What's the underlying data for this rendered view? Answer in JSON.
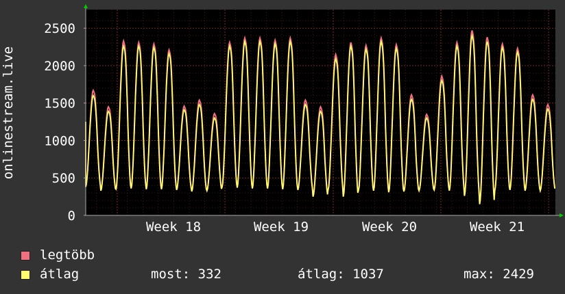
{
  "chart_data": {
    "type": "line",
    "ylabel": "onlinestream.live",
    "yticks": [
      0,
      500,
      1000,
      1500,
      2000,
      2500
    ],
    "ylim": [
      0,
      2700
    ],
    "xticks": [
      "Week 18",
      "Week 19",
      "Week 20",
      "Week 21"
    ],
    "grid": true,
    "colors": {
      "background": "#333333",
      "plot_bg": "#000000",
      "grid": "#7a2a2a",
      "axis": "#aaaaaa",
      "max_series": "#f07080",
      "avg_series": "#ffff70"
    },
    "daily_peaks_max": [
      1670,
      1450,
      2330,
      2310,
      2290,
      2210,
      1460,
      1540,
      1360,
      2310,
      2370,
      2370,
      2340,
      2370,
      1540,
      1450,
      2150,
      2310,
      2270,
      2370,
      2280,
      1610,
      1350,
      1860,
      2310,
      2470,
      2380,
      2290,
      2230,
      1610,
      1480
    ],
    "daily_peaks_avg": [
      1600,
      1390,
      2260,
      2260,
      2240,
      2160,
      1410,
      1480,
      1300,
      2260,
      2320,
      2320,
      2290,
      2320,
      1480,
      1390,
      2090,
      2260,
      2220,
      2320,
      2230,
      1550,
      1300,
      1800,
      2260,
      2400,
      2320,
      2240,
      2180,
      1550,
      1420
    ],
    "daily_troughs": [
      380,
      330,
      350,
      360,
      350,
      350,
      340,
      320,
      330,
      380,
      370,
      360,
      360,
      350,
      340,
      250,
      340,
      250,
      330,
      330,
      310,
      320,
      330,
      340,
      330,
      260,
      150,
      330,
      340,
      330,
      330
    ],
    "series": [
      {
        "name": "legtöbb"
      },
      {
        "name": "átlag"
      }
    ]
  },
  "legend": {
    "max_label": "legtöbb",
    "avg_label": "átlag"
  },
  "stats": {
    "now": "most: 332",
    "avg": "átlag: 1037",
    "max": "max: 2429"
  }
}
